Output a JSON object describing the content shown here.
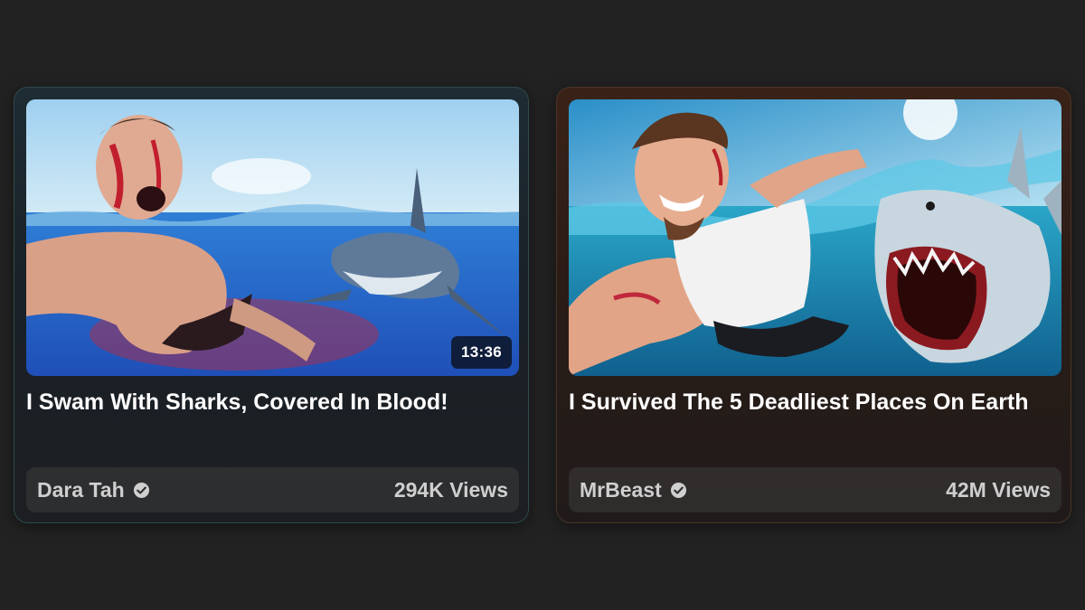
{
  "videos": [
    {
      "title": "I Swam With Sharks, Covered In Blood!",
      "duration": "13:36",
      "channel": "Dara Tah",
      "verified": true,
      "views": "294K Views",
      "thumbnail_icon": "shark-thumbnail"
    },
    {
      "title": "I Survived The 5 Deadliest Places On Earth",
      "channel": "MrBeast",
      "verified": true,
      "views": "42M Views",
      "thumbnail_icon": "shark-thumbnail"
    }
  ],
  "colors": {
    "background": "#222222",
    "text_primary": "#ffffff",
    "text_secondary": "#cfcfcf",
    "left_card_tint": "#1e2c34",
    "right_card_tint": "#3a2218"
  }
}
